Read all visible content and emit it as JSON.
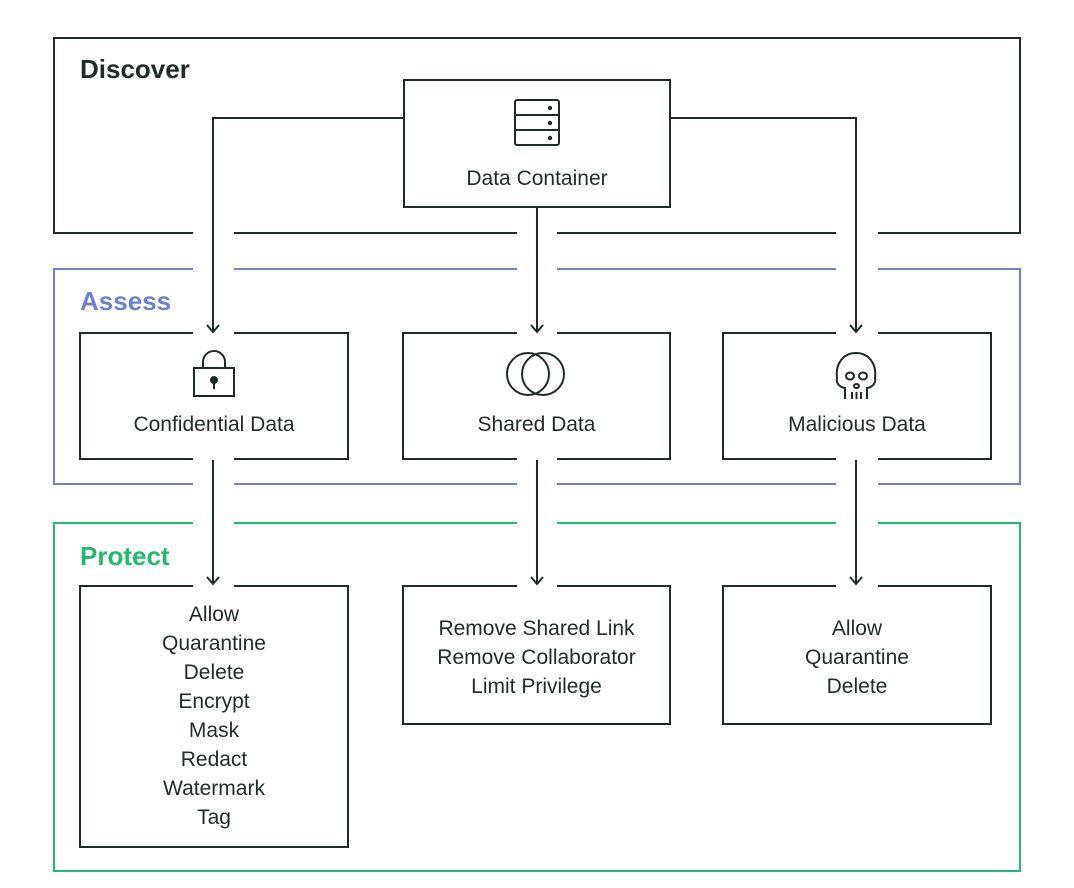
{
  "colors": {
    "discover": "#1f2b2a",
    "assess": "#6e7fd6",
    "protect": "#22bb6c",
    "line": "#1f2b2a"
  },
  "discover": {
    "title": "Discover",
    "container": {
      "label": "Data Container",
      "icon": "server-icon"
    }
  },
  "assess": {
    "title": "Assess",
    "items": [
      {
        "label": "Confidential Data",
        "icon": "lock-icon"
      },
      {
        "label": "Shared Data",
        "icon": "overlapping-circles-icon"
      },
      {
        "label": "Malicious Data",
        "icon": "skull-icon"
      }
    ]
  },
  "protect": {
    "title": "Protect",
    "groups": [
      {
        "actions": [
          "Allow",
          "Quarantine",
          "Delete",
          "Encrypt",
          "Mask",
          "Redact",
          "Watermark",
          "Tag"
        ]
      },
      {
        "actions": [
          "Remove Shared Link",
          "Remove Collaborator",
          "Limit Privilege"
        ]
      },
      {
        "actions": [
          "Allow",
          "Quarantine",
          "Delete"
        ]
      }
    ]
  }
}
